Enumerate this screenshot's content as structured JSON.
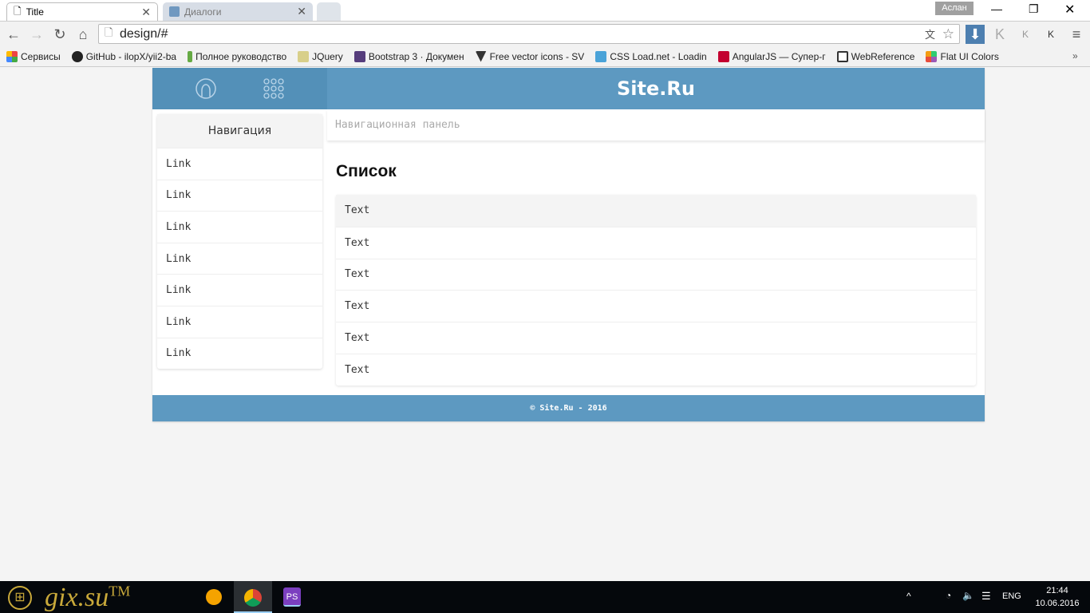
{
  "browser": {
    "tabs": [
      {
        "label": "Title",
        "active": true
      },
      {
        "label": "Диалоги",
        "active": false
      }
    ],
    "profile": "Аслан",
    "url": "design/#",
    "bookmarks": [
      {
        "label": "Сервисы",
        "color": "#e44"
      },
      {
        "label": "GitHub - ilopX/yii2-ba",
        "color": "#222"
      },
      {
        "label": "Полное руководство",
        "color": "#6a4"
      },
      {
        "label": "JQuery",
        "color": "#d8cf8a"
      },
      {
        "label": "Bootstrap 3 · Докумен",
        "color": "#563d7c"
      },
      {
        "label": "Free vector icons - SV",
        "color": "#333"
      },
      {
        "label": "CSS Load.net - Loadin",
        "color": "#4aa3d8"
      },
      {
        "label": "AngularJS — Супер-г",
        "color": "#c3002f"
      },
      {
        "label": "WebReference",
        "color": "#333"
      },
      {
        "label": "Flat UI Colors",
        "color": "#e67e22"
      }
    ]
  },
  "site": {
    "brand": "Site.Ru",
    "sidebar": {
      "title": "Навигация",
      "links": [
        "Link",
        "Link",
        "Link",
        "Link",
        "Link",
        "Link",
        "Link"
      ]
    },
    "breadcrumb": "Навигационная панель",
    "list_title": "Список",
    "list_items": [
      "Text",
      "Text",
      "Text",
      "Text",
      "Text",
      "Text"
    ],
    "footer": "© Site.Ru - 2016",
    "colors": {
      "header": "#5d99c1",
      "header_left": "#5390b8"
    }
  },
  "taskbar": {
    "watermark": "gix.su™",
    "lang": "ENG",
    "time": "21:44",
    "date": "10.06.2016"
  }
}
